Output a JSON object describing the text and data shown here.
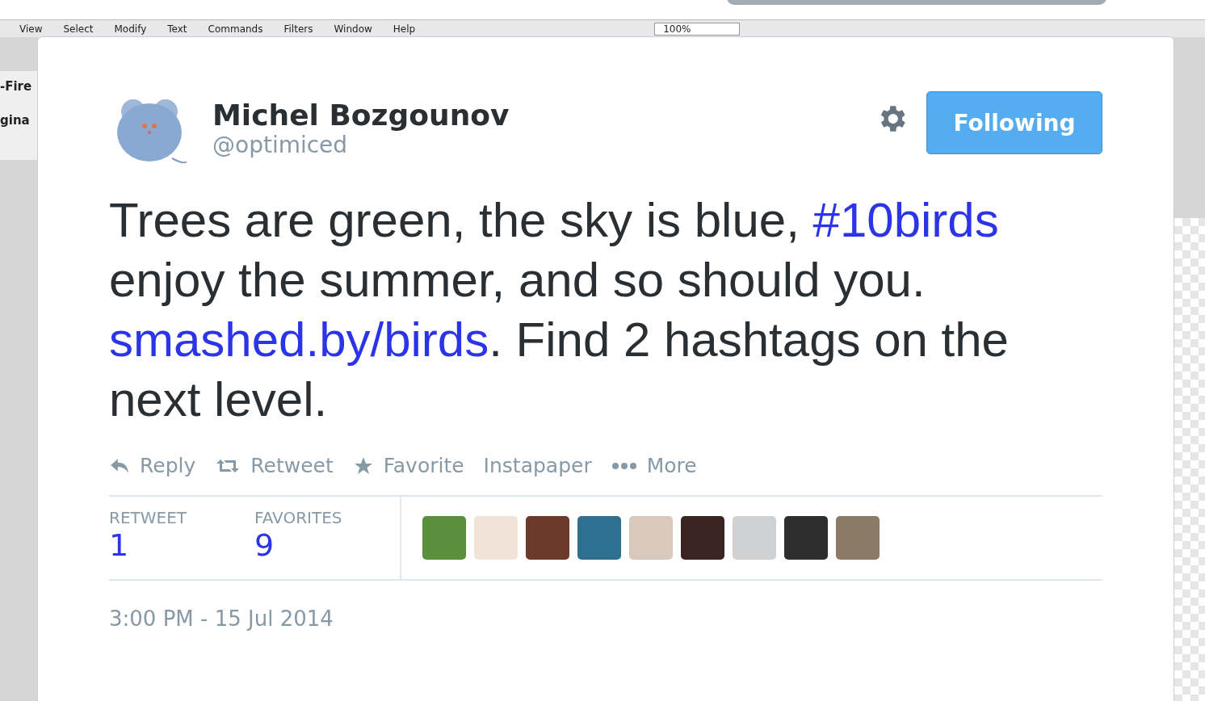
{
  "background": {
    "menu": [
      "View",
      "Select",
      "Modify",
      "Text",
      "Commands",
      "Filters",
      "Window",
      "Help"
    ],
    "zoom": "100%",
    "panel_texts": [
      "-Fire",
      "gina"
    ]
  },
  "tweet": {
    "name": "Michel Bozgounov",
    "handle": "@optimiced",
    "follow_button": "Following",
    "text": [
      {
        "kind": "text",
        "text": "Trees are green, the sky is blue, "
      },
      {
        "kind": "hashtag",
        "text": "#10birds"
      },
      {
        "kind": "text",
        "text": " enjoy the summer, and so should you. "
      },
      {
        "kind": "link",
        "text": "smashed.by/birds"
      },
      {
        "kind": "text",
        "text": ". Find 2 hashtags on the next level."
      }
    ],
    "actions": [
      {
        "kind": "reply",
        "label": "Reply"
      },
      {
        "kind": "retweet",
        "label": "Retweet"
      },
      {
        "kind": "favorite",
        "label": "Favorite"
      },
      {
        "kind": "plain",
        "label": "Instapaper"
      },
      {
        "kind": "more",
        "label": "More"
      }
    ],
    "stats": [
      {
        "label": "RETWEET",
        "value": "1"
      },
      {
        "label": "FAVORITES",
        "value": "9"
      }
    ],
    "favoriters": [
      {
        "color": "#5a8f3c"
      },
      {
        "color": "#f2e3d8"
      },
      {
        "color": "#6b3a2a"
      },
      {
        "color": "#2f6f8f"
      },
      {
        "color": "#d9c8bc"
      },
      {
        "color": "#3a2320"
      },
      {
        "color": "#cfd1d3"
      },
      {
        "color": "#2e2e2e"
      },
      {
        "color": "#8a7a66"
      }
    ],
    "timestamp": "3:00 PM - 15 Jul 2014"
  }
}
